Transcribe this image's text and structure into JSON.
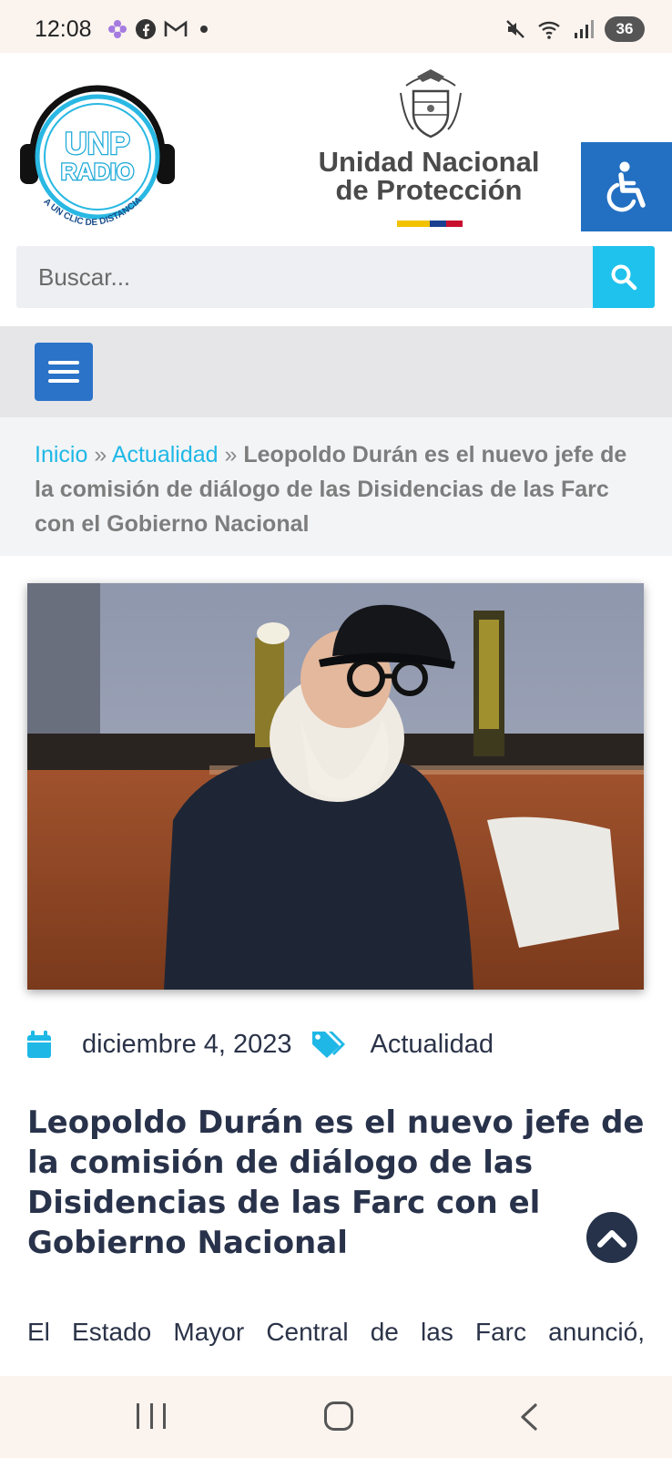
{
  "status_bar": {
    "time": "12:08",
    "battery": "36"
  },
  "header": {
    "radio_logo": {
      "line1": "UNP",
      "line2": "RADIO",
      "tagline": "A UN CLIC DE DISTANCIA"
    },
    "agency_line1": "Unidad Nacional",
    "agency_line2": "de Protección",
    "flag_colors": [
      "#f2c200",
      "#1b3f8f",
      "#c8102e"
    ]
  },
  "search": {
    "placeholder": "Buscar..."
  },
  "breadcrumb": {
    "home": "Inicio",
    "separator": "»",
    "section": "Actualidad",
    "current": "Leopoldo Durán es el nuevo jefe de la comisión de diálogo de las Disidencias de las Farc con el Gobierno Nacional"
  },
  "post": {
    "date": "diciembre 4, 2023",
    "category": "Actualidad",
    "title": "Leopoldo Durán es el nuevo jefe de la comisión de diálogo de las Disidencias de las Farc con el Gobierno Nacional",
    "body_first_line": "El Estado Mayor Central de las Farc anunció,"
  },
  "icons": {
    "access": "wheelchair-icon",
    "search": "search-icon",
    "menu": "hamburger-icon",
    "date": "calendar-icon",
    "category": "tag-icon",
    "to_top": "chevron-up-icon"
  },
  "colors": {
    "accent_cyan": "#1fc2ec",
    "accent_blue": "#2a73c9",
    "title_dark": "#28324a"
  }
}
